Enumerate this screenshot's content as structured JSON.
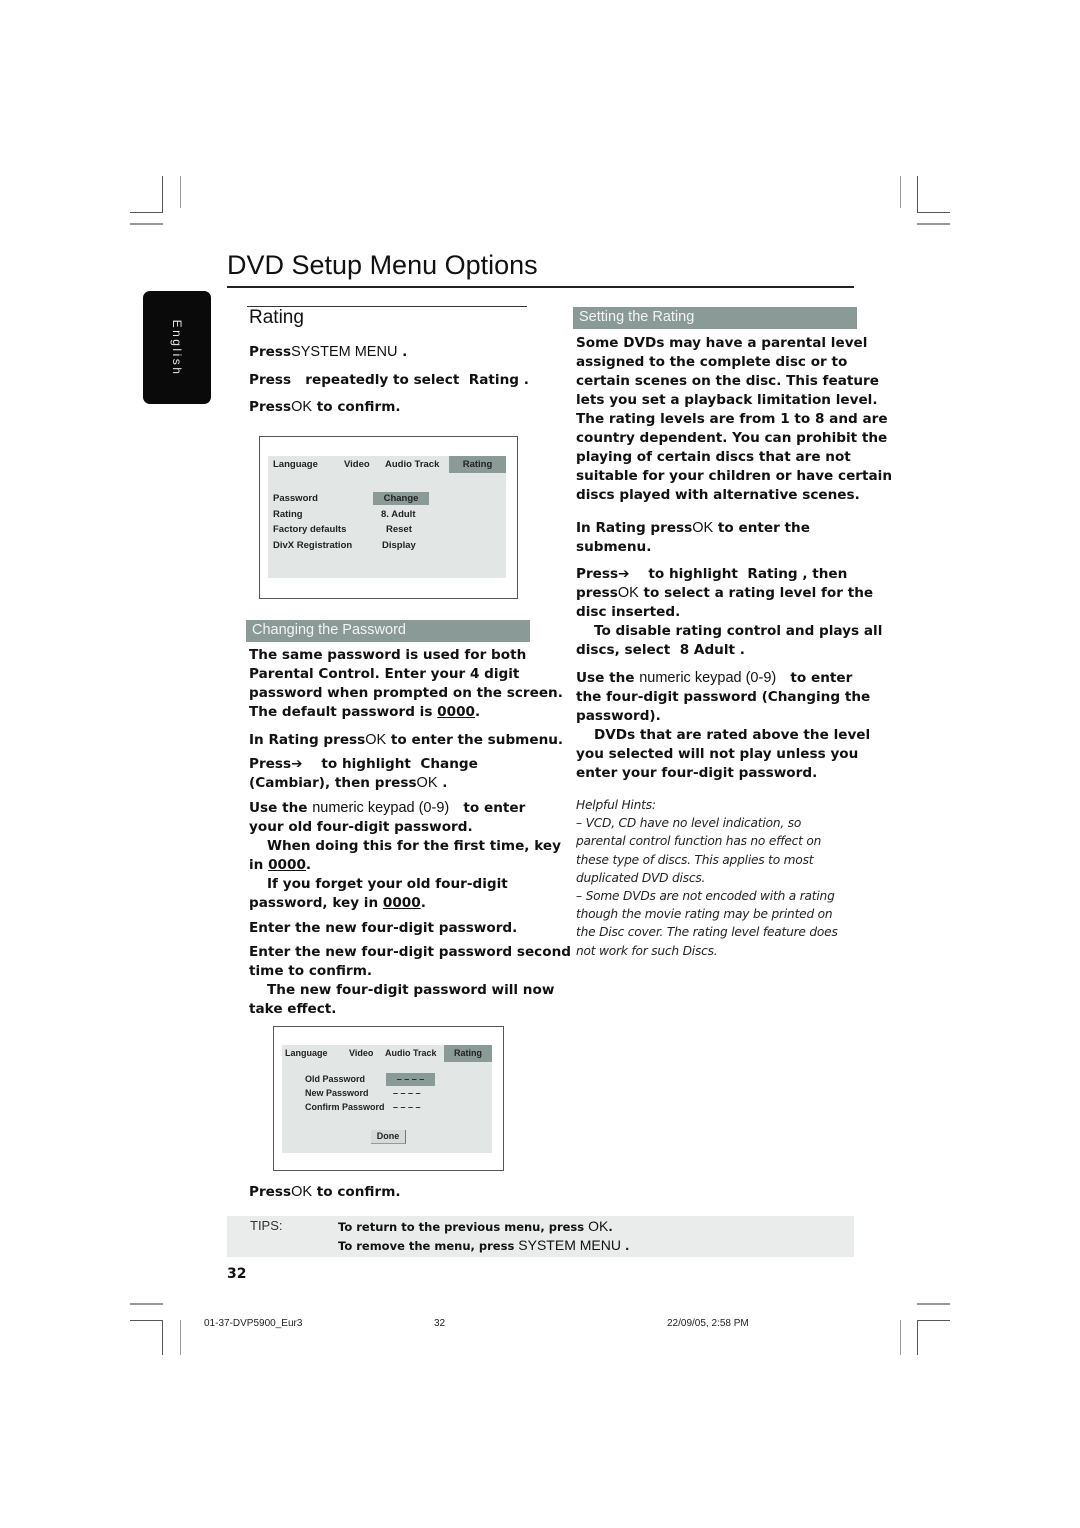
{
  "page_title": "DVD Setup Menu Options",
  "language_tab": "English",
  "rating_section": {
    "heading": "Rating",
    "steps": [
      {
        "prefix": "Press",
        "key": "SYSTEM MENU",
        "suffix": " ."
      },
      {
        "text": "Press   repeatedly to select  Rating ."
      },
      {
        "prefix": "Press",
        "key": "OK",
        "suffix": "  to confirm."
      }
    ]
  },
  "osd_menu_1": {
    "tabs": [
      "Language",
      "Video",
      "Audio Track",
      "Rating"
    ],
    "selected_tab": "Rating",
    "rows": [
      {
        "label": "Password",
        "value": "Change",
        "selected": true
      },
      {
        "label": "Rating",
        "value": "8. Adult"
      },
      {
        "label": "Factory defaults",
        "value": "Reset"
      },
      {
        "label": "DivX Registration",
        "value": "Display"
      }
    ]
  },
  "changing_password": {
    "heading": "Changing the Password",
    "intro_lines": [
      "The same password is used for both",
      "Parental Control. Enter your 4 digit",
      "password when prompted on the screen.",
      "The default password is"
    ],
    "default_password": "0000",
    "step1": {
      "prefix": "In Rating press",
      "key": "OK",
      "suffix": "  to enter the submenu."
    },
    "step2_line1": "Press➔    to highlight  Change",
    "step2_line2": {
      "prefix": "(Cambiar), then press",
      "key": "OK",
      "suffix": " ."
    },
    "step3_line1": {
      "prefix": "Use the ",
      "key": "numeric keypad (0-9)",
      "suffix": "   to enter"
    },
    "step3_line2": "your old four-digit password.",
    "note1_line1": "When doing this for the first time, key",
    "note1_line2_prefix": "in ",
    "note1_code": "0000",
    "note2_line1": "If you forget your old four-digit",
    "note2_line2_prefix": "password, key in ",
    "note2_code": "0000",
    "step4": "Enter the new four-digit password.",
    "step5_line1": "Enter the new four-digit password second",
    "step5_line2": "time to confirm.",
    "note3_line1": "The new four-digit password will now",
    "note3_line2": "take effect."
  },
  "osd_menu_2": {
    "tabs": [
      "Language",
      "Video",
      "Audio Track",
      "Rating"
    ],
    "selected_tab": "Rating",
    "fields": [
      {
        "label": "Old Password",
        "value": "– – – –",
        "selected": true
      },
      {
        "label": "New Password",
        "value": "– – – –"
      },
      {
        "label": "Confirm Password",
        "value": "– – – –"
      }
    ],
    "done_button": "Done"
  },
  "confirm_step": {
    "prefix": "Press",
    "key": "OK",
    "suffix": "  to confirm."
  },
  "setting_rating": {
    "heading": "Setting the Rating",
    "intro_lines": [
      "Some DVDs may have a parental level",
      "assigned to the complete disc or to",
      "certain scenes on the disc. This feature",
      "lets you set a playback limitation level.",
      "The rating levels are from 1 to 8 and are",
      "country dependent. You can prohibit the",
      "playing of certain discs that are not",
      "suitable for your children or have certain",
      "discs played with alternative scenes."
    ],
    "step1_line1": {
      "prefix": "In Rating press",
      "key": "OK",
      "suffix": "  to enter the"
    },
    "step1_line2": "submenu.",
    "step2_line1": "Press➔    to highlight  Rating , then",
    "step2_line2": {
      "prefix": "press",
      "key": "OK",
      "suffix": "  to select a rating level for the"
    },
    "step2_line3": "disc inserted.",
    "note1_line1": "To disable rating control and plays all",
    "note1_line2": "discs, select  8 Adult .",
    "step3_line1": {
      "prefix": "Use the ",
      "key": "numeric keypad (0-9)",
      "suffix": "   to enter"
    },
    "step3_line2": "the four-digit password (Changing the",
    "step3_line3": "password).",
    "note2_line1": "DVDs that are rated above the level",
    "note2_line2": "you selected will not play unless you",
    "note2_line3": "enter your four-digit password."
  },
  "helpful_hints": {
    "title": "Helpful Hints:",
    "lines": [
      "–  VCD, CD have no level indication, so",
      "parental control function has no effect on",
      "these type of discs. This applies to most",
      "duplicated DVD discs.",
      "–  Some DVDs are not encoded with a rating",
      "though the movie rating may be printed on",
      "the Disc cover. The rating level feature does",
      "not work for such Discs."
    ]
  },
  "tips": {
    "label": "TIPS:",
    "line1": {
      "prefix": "To return to the previous menu, press ",
      "key": "OK",
      "suffix": "."
    },
    "line2": {
      "prefix": "To remove the menu, press ",
      "key": "SYSTEM MENU",
      "suffix": " ."
    }
  },
  "page_number": "32",
  "footer": {
    "file": "01-37-DVP5900_Eur3",
    "page": "32",
    "date": "22/09/05, 2:58 PM"
  }
}
